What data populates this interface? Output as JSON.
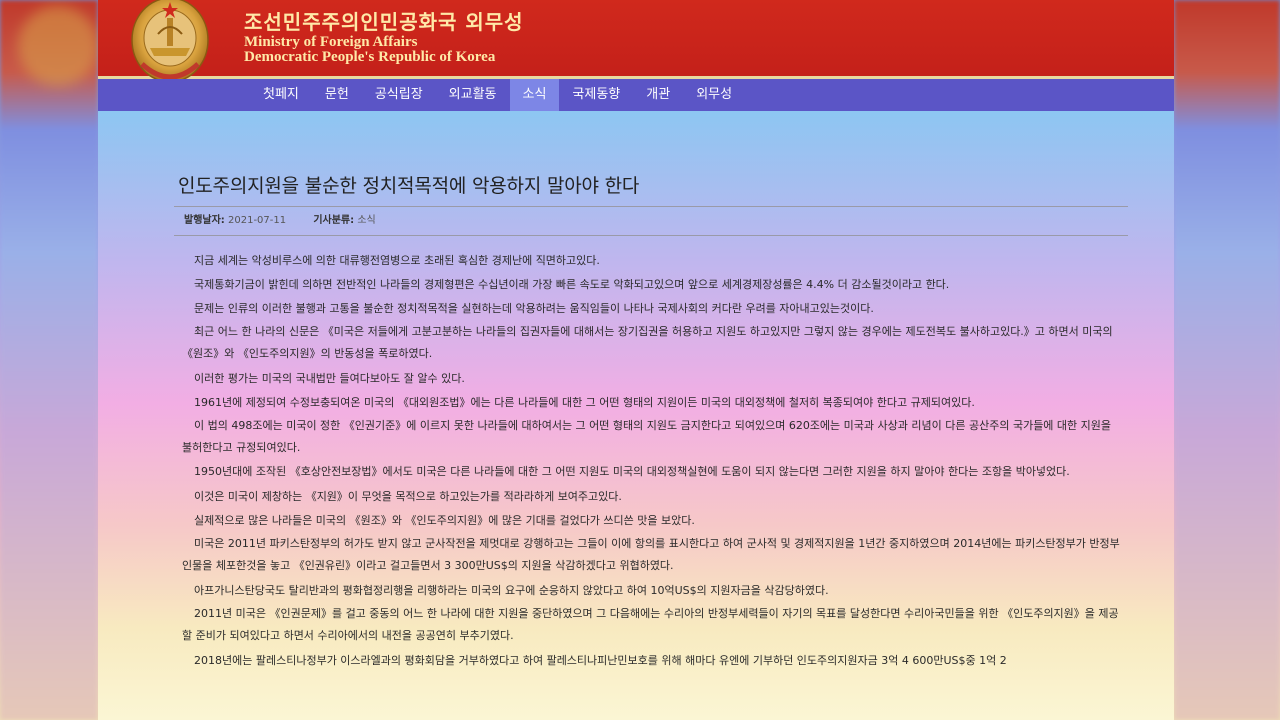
{
  "header": {
    "title_ko": "조선민주주의인민공화국 외무성",
    "title_en_line1": "Ministry of Foreign Affairs",
    "title_en_line2": "Democratic People's Republic of Korea"
  },
  "nav": {
    "items": [
      "첫페지",
      "문헌",
      "공식립장",
      "외교활동",
      "소식",
      "국제동향",
      "개관",
      "외무성"
    ],
    "active": "소식"
  },
  "article": {
    "title": "인도주의지원을 불순한 정치적목적에 악용하지 말아야 한다",
    "meta": {
      "date_label": "발행날자:",
      "date_value": "2021-07-11",
      "category_label": "기사분류:",
      "category_value": "소식"
    },
    "paragraphs": [
      "지금 세계는 악성비루스에 의한 대류행전염병으로 초래된 혹심한 경제난에 직면하고있다.",
      "국제통화기금이 밝힌데 의하면 전반적인 나라들의 경제형편은 수십년이래 가장 빠른 속도로 악화되고있으며 앞으로 세계경제장성률은 4.4% 더 감소될것이라고 한다.",
      "문제는 인류의 이러한 불행과 고통을 불순한 정치적목적을 실현하는데 악용하려는 움직임들이 나타나 국제사회의 커다란 우려를 자아내고있는것이다.",
      "최근 어느 한 나라의 신문은 《미국은 저들에게 고분고분하는 나라들의 집권자들에 대해서는 장기집권을 허용하고 지원도 하고있지만 그렇지 않는 경우에는 제도전복도 불사하고있다.》고 하면서 미국의 《원조》와 《인도주의지원》의 반동성을 폭로하였다.",
      "이러한 평가는 미국의 국내법만 들여다보아도 잘 알수 있다.",
      "1961년에 제정되여 수정보충되여온 미국의 《대외원조법》에는 다른 나라들에 대한 그 어떤 형태의 지원이든 미국의 대외정책에 철저히 복종되여야 한다고 규제되여있다.",
      "이 법의 498조에는 미국이 정한 《인권기준》에 이르지 못한 나라들에 대하여서는 그 어떤 형태의 지원도 금지한다고 되여있으며 620조에는 미국과 사상과 리념이 다른 공산주의 국가들에 대한 지원을 불허한다고 규정되여있다.",
      "1950년대에 조작된 《호상안전보장법》에서도 미국은 다른 나라들에 대한 그 어떤 지원도 미국의 대외정책실현에 도움이 되지 않는다면 그러한 지원을 하지 말아야 한다는 조항을 박아넣었다.",
      "이것은 미국이 제창하는 《지원》이 무엇을 목적으로 하고있는가를 적라라하게 보여주고있다.",
      "실제적으로 많은 나라들은 미국의 《원조》와 《인도주의지원》에 많은 기대를 걸었다가 쓰디쓴 맛을 보았다.",
      "미국은 2011년 파키스탄정부의 허가도 받지 않고 군사작전을 제멋대로 강행하고는 그들이 이에 항의를 표시한다고 하여 군사적 및 경제적지원을 1년간 중지하였으며 2014년에는 파키스탄정부가 반정부인물을 체포한것을 놓고 《인권유린》이라고 걸고들면서 3 300만US$의 지원을 삭감하겠다고 위협하였다.",
      "아프가니스탄당국도 탈리반과의 평화협정리행을 리행하라는 미국의 요구에 순응하지 않았다고 하여 10억US$의 지원자금을 삭감당하였다.",
      "2011년 미국은 《인권문제》를 걸고 중동의 어느 한 나라에 대한 지원을 중단하였으며 그 다음해에는 수리아의 반정부세력들이 자기의 목표를 달성한다면 수리아국민들을 위한 《인도주의지원》을 제공할 준비가 되여있다고 하면서 수리아에서의 내전을 공공연히 부추기였다.",
      "2018년에는 팔레스티나정부가 이스라엘과의 평화회담을 거부하였다고 하여 팔레스티나피난민보호를 위해 해마다 유엔에 기부하던 인도주의지원자금 3억 4 600만US$중 1억 2"
    ]
  },
  "colors": {
    "header_red": "#c4201a",
    "header_text": "#ffe9a8",
    "nav_bg": "#5b55c6",
    "nav_active": "#7d86e6"
  }
}
